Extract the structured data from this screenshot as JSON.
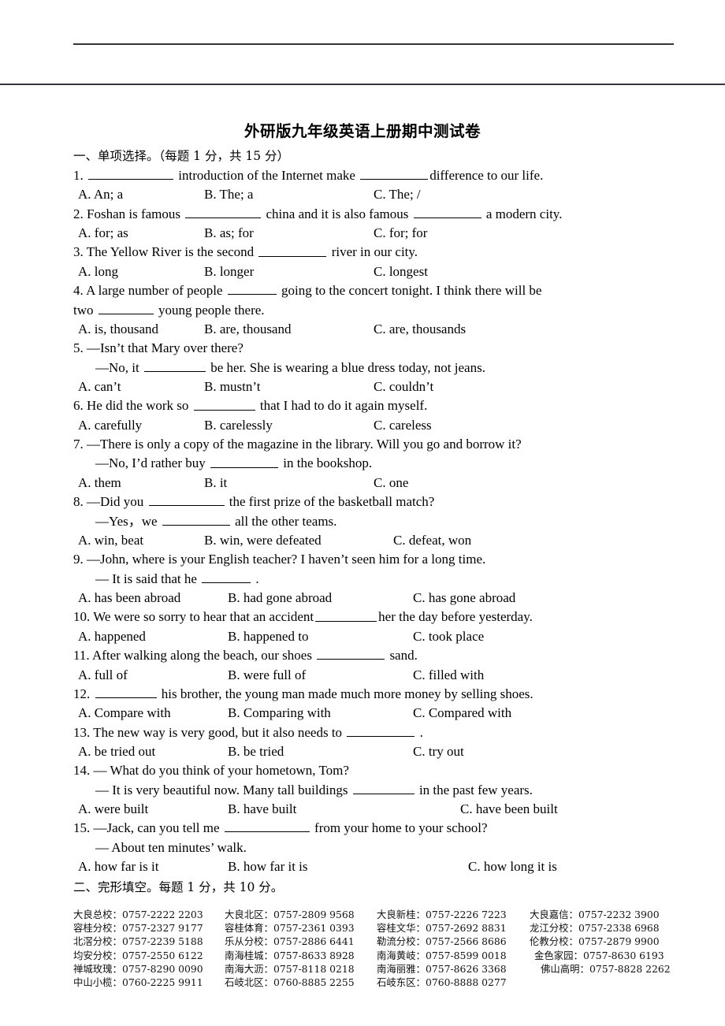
{
  "document": {
    "title": "外研版九年级英语上册期中测试卷",
    "sections": [
      {
        "id": "section-1",
        "heading": "一、单项选择。（每题 1 分，共 15 分）"
      },
      {
        "id": "section-2",
        "heading": "二、完形填空。每题 1 分，共 10 分。"
      }
    ],
    "questions": [
      {
        "number": "1.",
        "stem_a": "introduction of the Internet make",
        "stem_b": "difference to our life.",
        "options": [
          "A. An; a",
          "B. The; a",
          "C. The; /"
        ]
      },
      {
        "number": "2.",
        "stem_a": "Foshan is famous",
        "stem_b": "china and it is also famous",
        "stem_c": "a modern city.",
        "options": [
          "A. for; as",
          "B. as; for",
          "C. for; for"
        ]
      },
      {
        "number": "3.",
        "stem_a": "The Yellow River is the second",
        "stem_b": "river in our city.",
        "options": [
          "A. long",
          "B. longer",
          "C. longest"
        ]
      },
      {
        "number": "4.",
        "stem_a": "A large number of people",
        "stem_b": "going to the concert tonight. I think there will be",
        "stem_c": "two",
        "stem_d": "young people there.",
        "options": [
          "A. is, thousand",
          "B. are, thousand",
          "C. are, thousands"
        ]
      },
      {
        "number": "5.",
        "line1": "—Isn’t that Mary over there?",
        "line2_a": "—No, it",
        "line2_b": "be her. She is wearing a blue dress today, not jeans.",
        "options": [
          "A. can’t",
          "B. mustn’t",
          "C. couldn’t"
        ]
      },
      {
        "number": "6.",
        "stem_a": "He did the work so",
        "stem_b": "that I had to do it again myself.",
        "options": [
          "A. carefully",
          "B. carelessly",
          "C. careless"
        ]
      },
      {
        "number": "7.",
        "line1": "—There is only a copy of the magazine in the library. Will you go and borrow it?",
        "line2_a": "—No, I’d rather buy",
        "line2_b": "in the bookshop.",
        "options": [
          "A. them",
          "B. it",
          "C. one"
        ]
      },
      {
        "number": "8.",
        "line1_a": "—Did you",
        "line1_b": "the first prize of the basketball match?",
        "line2_a": "—Yes，we",
        "line2_b": "all the other teams.",
        "options": [
          "A. win, beat",
          "B. win, were defeated",
          "C. defeat, won"
        ]
      },
      {
        "number": "9.",
        "line1": "—John, where is your English teacher? I haven’t seen him for a long time.",
        "line2_a": "— It is said that he",
        "line2_b": ".",
        "options": [
          "A. has been abroad",
          "B. had gone abroad",
          "C. has gone abroad"
        ]
      },
      {
        "number": "10.",
        "stem_a": "We were so sorry to hear that an accident",
        "stem_b": "her the day before yesterday.",
        "options": [
          "A. happened",
          "B. happened to",
          "C. took place"
        ]
      },
      {
        "number": "11.",
        "stem_a": "After walking along the beach, our shoes",
        "stem_b": "sand.",
        "options": [
          "A. full of",
          "B. were full of",
          "C. filled with"
        ]
      },
      {
        "number": "12.",
        "stem_a": "",
        "stem_b": "his brother, the young man made much more money by selling shoes.",
        "options": [
          "A. Compare with",
          "B. Comparing with",
          "C. Compared with"
        ]
      },
      {
        "number": "13.",
        "stem_a": "The new way is very good, but it also needs to",
        "stem_b": ".",
        "options": [
          "A. be tried out",
          "B. be tried",
          "C. try out"
        ]
      },
      {
        "number": "14.",
        "line1": "— What do you think of your hometown, Tom?",
        "line2_a": "— It is very beautiful now. Many tall buildings",
        "line2_b": "in the past few years.",
        "options": [
          "A. were built",
          "B. have built",
          "C. have been built"
        ]
      },
      {
        "number": "15.",
        "line1_a": "—Jack, can you tell me",
        "line1_b": "from your home to your school?",
        "line2": "— About ten minutes’ walk.",
        "options": [
          "A. how far is it",
          "B. how far it is",
          "C. how long it is"
        ]
      }
    ]
  },
  "footer": {
    "contacts": [
      [
        {
          "name": "大良总校：",
          "tel": "0757-2222  2203"
        },
        {
          "name": "大良北区：",
          "tel": "0757-2809  9568"
        },
        {
          "name": "大良新桂：",
          "tel": "0757-2226  7223"
        },
        {
          "name": "大良嘉信：",
          "tel": "0757-2232  3900"
        }
      ],
      [
        {
          "name": "容桂分校：",
          "tel": "0757-2327  9177"
        },
        {
          "name": "容桂体育：",
          "tel": "0757-2361  0393"
        },
        {
          "name": "容桂文华：",
          "tel": "0757-2692  8831"
        },
        {
          "name": "龙江分校：",
          "tel": "0757-2338  6968"
        }
      ],
      [
        {
          "name": "北滘分校：",
          "tel": "0757-2239  5188"
        },
        {
          "name": "乐从分校：",
          "tel": "0757-2886  6441"
        },
        {
          "name": "勒流分校：",
          "tel": "0757-2566  8686"
        },
        {
          "name": "伦教分校：",
          "tel": "0757-2879  9900"
        }
      ],
      [
        {
          "name": "均安分校：",
          "tel": "0757-2550  6122"
        },
        {
          "name": "南海桂城：",
          "tel": "0757-8633 8928"
        },
        {
          "name": "南海黄岐：",
          "tel": "0757-8599 0018"
        },
        {
          "name": "金色家园：",
          "tel": "0757-8630 6193"
        }
      ],
      [
        {
          "name": "禅城玫瑰：",
          "tel": "0757-8290 0090"
        },
        {
          "name": "南海大沥：",
          "tel": "0757-8118 0218"
        },
        {
          "name": "南海丽雅：",
          "tel": "0757-8626 3368"
        },
        {
          "name": "佛山高明：",
          "tel": "0757-8828 2262"
        }
      ],
      [
        {
          "name": "中山小榄：",
          "tel": "0760-2225 9911"
        },
        {
          "name": "石岐北区：",
          "tel": "0760-8885 2255"
        },
        {
          "name": "石岐东区：",
          "tel": "0760-8888 0277"
        },
        {
          "name": "",
          "tel": ""
        }
      ]
    ]
  }
}
